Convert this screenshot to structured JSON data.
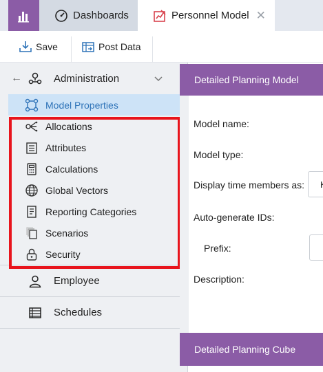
{
  "tabs": {
    "dashboards_label": "Dashboards",
    "personnel_label": "Personnel Model"
  },
  "toolbar": {
    "save_label": "Save",
    "post_label": "Post Data"
  },
  "sidebar": {
    "admin_label": "Administration",
    "items": [
      {
        "label": "Model Properties",
        "icon": "model-properties-icon",
        "active": true
      },
      {
        "label": "Allocations",
        "icon": "allocations-icon"
      },
      {
        "label": "Attributes",
        "icon": "attributes-icon"
      },
      {
        "label": "Calculations",
        "icon": "calculator-icon"
      },
      {
        "label": "Global Vectors",
        "icon": "globe-icon"
      },
      {
        "label": "Reporting Categories",
        "icon": "report-icon"
      },
      {
        "label": "Scenarios",
        "icon": "scenarios-icon"
      },
      {
        "label": "Security",
        "icon": "lock-icon"
      }
    ],
    "employee_label": "Employee",
    "schedules_label": "Schedules"
  },
  "main": {
    "section1_title": "Detailed Planning Model",
    "model_name_label": "Model name:",
    "model_type_label": "Model type:",
    "display_time_label": "Display time members as:",
    "display_time_value": "K",
    "auto_ids_label": "Auto-generate IDs:",
    "prefix_label": "Prefix:",
    "description_label": "Description:",
    "section2_title": "Detailed Planning Cube"
  },
  "colors": {
    "accent": "#8b5ca6",
    "active_bg": "#cde3f7",
    "active_text": "#2e73b8",
    "highlight": "#e8141c"
  }
}
